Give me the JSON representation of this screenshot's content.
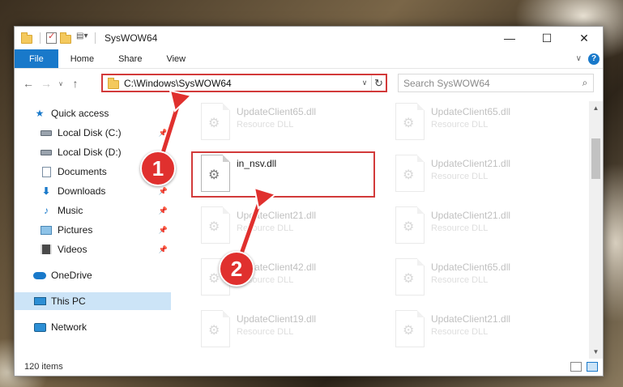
{
  "window": {
    "title": "SysWOW64",
    "minimize": "—",
    "maximize": "☐",
    "close": "✕"
  },
  "ribbon": {
    "tabs": [
      "File",
      "Home",
      "Share",
      "View"
    ],
    "help": "?",
    "expand": "∨"
  },
  "nav": {
    "back": "←",
    "forward": "→",
    "recent": "∨",
    "up": "↑"
  },
  "address": {
    "path": "C:\\Windows\\SysWOW64",
    "dropdown": "∨",
    "refresh": "↻"
  },
  "search": {
    "placeholder": "Search SysWOW64",
    "icon": "⌕"
  },
  "sidebar": {
    "items": [
      {
        "label": "Quick access",
        "icon": "star-icon"
      },
      {
        "label": "Local Disk (C:)",
        "icon": "drive-icon"
      },
      {
        "label": "Local Disk (D:)",
        "icon": "drive-icon"
      },
      {
        "label": "Documents",
        "icon": "documents-icon"
      },
      {
        "label": "Downloads",
        "icon": "downloads-icon"
      },
      {
        "label": "Music",
        "icon": "music-icon"
      },
      {
        "label": "Pictures",
        "icon": "pictures-icon"
      },
      {
        "label": "Videos",
        "icon": "videos-icon"
      },
      {
        "label": "OneDrive",
        "icon": "onedrive-icon"
      },
      {
        "label": "This PC",
        "icon": "this-pc-icon"
      },
      {
        "label": "Network",
        "icon": "network-icon"
      }
    ],
    "pin_glyph": "📌"
  },
  "files": [
    {
      "name": "UpdateClient65.dll",
      "type": "Resource DLL"
    },
    {
      "name": "UpdateClient65.dll",
      "type": "Resource DLL"
    },
    {
      "name": "in_nsv.dll",
      "type": ""
    },
    {
      "name": "UpdateClient21.dll",
      "type": "Resource DLL"
    },
    {
      "name": "UpdateClient21.dll",
      "type": "Resource DLL"
    },
    {
      "name": "UpdateClient21.dll",
      "type": "Resource DLL"
    },
    {
      "name": "UpdateClient42.dll",
      "type": "Resource DLL"
    },
    {
      "name": "UpdateClient65.dll",
      "type": "Resource DLL"
    },
    {
      "name": "UpdateClient19.dll",
      "type": "Resource DLL"
    },
    {
      "name": "UpdateClient21.dll",
      "type": "Resource DLL"
    }
  ],
  "status": {
    "count": "120 items"
  },
  "annotations": {
    "marker1": "1",
    "marker2": "2",
    "color": "#e0302e"
  },
  "colors": {
    "accent": "#1979ca",
    "highlight": "#d23a3a",
    "selected_bg": "#cce4f7"
  }
}
